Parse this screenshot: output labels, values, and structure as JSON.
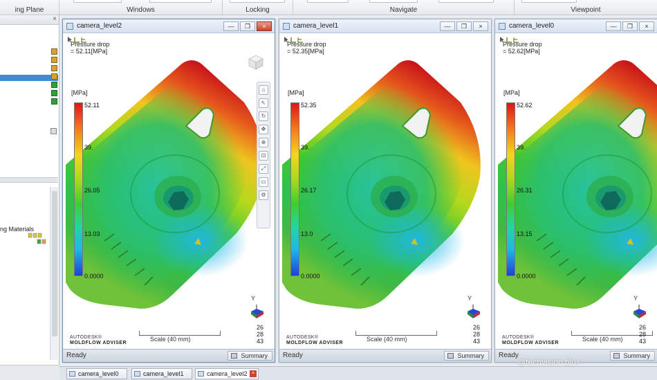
{
  "ribbon": {
    "groups": [
      {
        "label": "ing Plane"
      },
      {
        "label": "Windows"
      },
      {
        "label": "Locking"
      },
      {
        "label": "Navigate"
      },
      {
        "label": "Viewpoint"
      }
    ]
  },
  "left_panel": {
    "tree_text": "ng Materials",
    "badge_colors": [
      "#d8a233",
      "#d8a233",
      "#d8a233",
      "#d8a233",
      "#2f9f3a",
      "#2f9f3a",
      "#2f9f3a"
    ]
  },
  "windows": [
    {
      "title": "camera_level2",
      "result_name": "Pressure drop",
      "result_value": "= 52.11[MPa]",
      "unit": "[MPa]",
      "ticks": [
        "52.11",
        "39.",
        "26.05",
        "13.03",
        "0.0000"
      ],
      "axis_label": "Y",
      "scale": "Scale (40 mm)",
      "logo_top": "AUTODESK®",
      "logo_bottom": "MOLDFLOW ADVISER",
      "corner_numbers": [
        "26",
        "28",
        "43"
      ],
      "status": "Ready",
      "summary": "Summary",
      "close_glyph": "×",
      "restore_glyph": "❐",
      "min_glyph": "—"
    },
    {
      "title": "camera_level1",
      "result_name": "Pressure drop",
      "result_value": "= 52.35[MPa]",
      "unit": "[MPa]",
      "ticks": [
        "52.35",
        "39.",
        "26.17",
        "13.0",
        "0.0000"
      ],
      "axis_label": "Y",
      "scale": "Scale (40 mm)",
      "logo_top": "AUTODESK®",
      "logo_bottom": "MOLDFLOW ADVISER",
      "corner_numbers": [
        "26",
        "28",
        "43"
      ],
      "status": "Ready",
      "summary": "Summary",
      "close_glyph": "×",
      "restore_glyph": "❐",
      "min_glyph": "—"
    },
    {
      "title": "camera_level0",
      "result_name": "Pressure drop",
      "result_value": "= 52.62[MPa]",
      "unit": "[MPa]",
      "ticks": [
        "52.62",
        "39.",
        "26.31",
        "13.15",
        "0.0000"
      ],
      "axis_label": "Y",
      "scale": "Scale (40 mm)",
      "logo_top": "AUTODESK®",
      "logo_bottom": "MOLDFLOW ADVISER",
      "corner_numbers": [
        "26",
        "28",
        "43"
      ],
      "status": "Ready",
      "summary": "Summary",
      "close_glyph": "×",
      "restore_glyph": "❐",
      "min_glyph": "—"
    }
  ],
  "tabs": [
    {
      "label": "camera_level0"
    },
    {
      "label": "camera_level1"
    },
    {
      "label": "camera_level2",
      "close": "×"
    }
  ],
  "watermark": "@techvision plus",
  "colors": {
    "accent_selection": "#3d8bd6",
    "titlebar": "#d7e2f0",
    "colorbar_top": "#e0151a",
    "colorbar_bottom": "#1f3fd9"
  }
}
